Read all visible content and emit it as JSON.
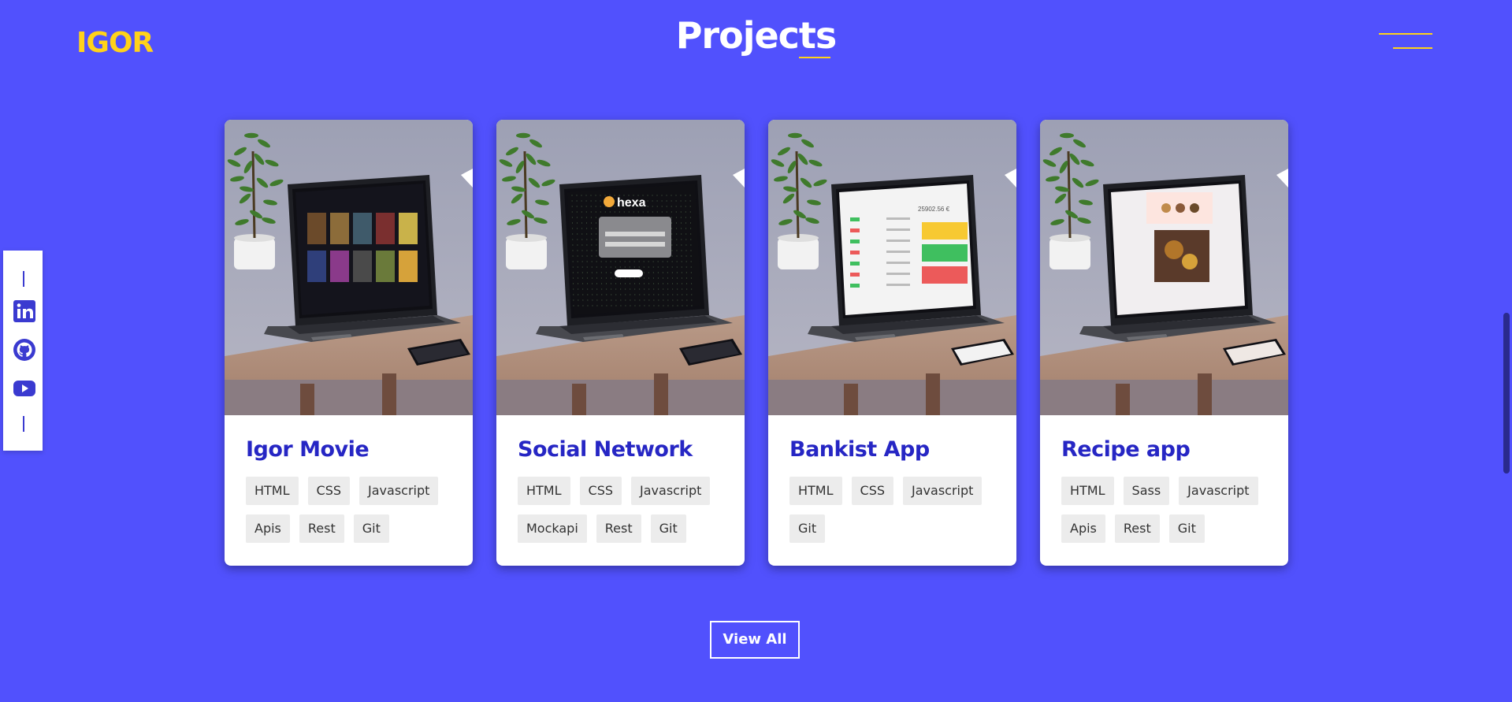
{
  "header": {
    "logo": "IGOR",
    "title": "Projects",
    "menu_icon": "hamburger-menu-icon"
  },
  "social": {
    "items": [
      {
        "name": "linkedin-icon"
      },
      {
        "name": "github-icon"
      },
      {
        "name": "youtube-icon"
      }
    ]
  },
  "projects": [
    {
      "title": "Igor Movie",
      "tags": [
        "HTML",
        "CSS",
        "Javascript",
        "Apis",
        "Rest",
        "Git"
      ],
      "screen": "movie"
    },
    {
      "title": "Social Network",
      "tags": [
        "HTML",
        "CSS",
        "Javascript",
        "Mockapi",
        "Rest",
        "Git"
      ],
      "screen": "hexa",
      "screen_text": "hexa"
    },
    {
      "title": "Bankist App",
      "tags": [
        "HTML",
        "CSS",
        "Javascript",
        "Git"
      ],
      "screen": "bank",
      "screen_text": "25902.56 €"
    },
    {
      "title": "Recipe app",
      "tags": [
        "HTML",
        "Sass",
        "Javascript",
        "Apis",
        "Rest",
        "Git"
      ],
      "screen": "recipe"
    }
  ],
  "view_all_label": "View All",
  "colors": {
    "background": "#5151fd",
    "accent": "#ffd21a",
    "card_title": "#2626c4",
    "tag_bg": "#ececec"
  }
}
